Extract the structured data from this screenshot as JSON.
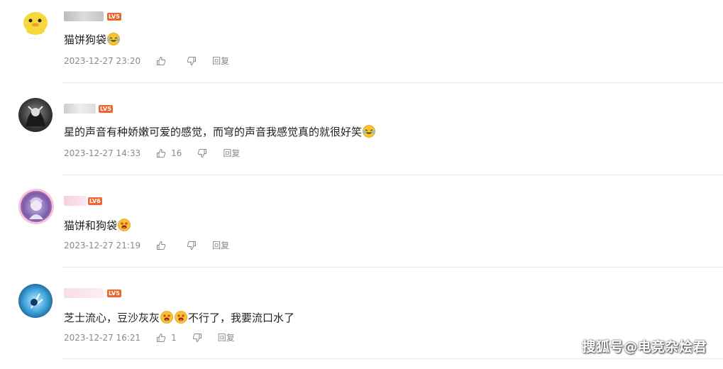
{
  "comments": [
    {
      "level": "LV5",
      "text": "猫饼狗袋",
      "emoji": "laughing-tears-icon",
      "time": "2023-12-27 23:20",
      "likes": "",
      "reply": "回复"
    },
    {
      "level": "LV5",
      "text": "星的声音有种娇嫩可爱的感觉，而穹的声音我感觉真的就很好笑",
      "emoji": "laughing-tears-icon",
      "time": "2023-12-27 14:33",
      "likes": "16",
      "reply": "回复"
    },
    {
      "level": "LV6",
      "text": "猫饼和狗袋",
      "emoji": "drooling-face-icon",
      "time": "2023-12-27 21:19",
      "likes": "",
      "reply": "回复"
    },
    {
      "level": "LV5",
      "text": "芝士流心，豆沙灰灰",
      "text_after": "不行了，我要流口水了",
      "emoji": "drooling-face-icon",
      "time": "2023-12-27 16:21",
      "likes": "1",
      "reply": "回复"
    }
  ],
  "colors": {
    "level_badge": "#f0652e",
    "meta_text": "#8a8a8a",
    "divider": "#e8e8e8"
  },
  "watermark": "搜狐号@电竞杂烩君"
}
